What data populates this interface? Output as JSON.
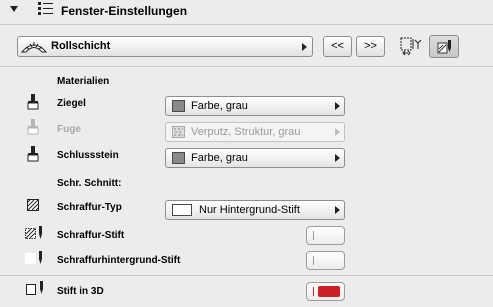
{
  "header": {
    "title": "Fenster-Einstellungen"
  },
  "profile": {
    "label": "Rollschicht",
    "prev_label": "<<",
    "next_label": ">>"
  },
  "materials": {
    "heading": "Materialien",
    "rows": [
      {
        "label": "Ziegel",
        "value": "Farbe, grau",
        "enabled": true
      },
      {
        "label": "Fuge",
        "value": "Verputz, Struktur, grau",
        "enabled": false
      },
      {
        "label": "Schlussstein",
        "value": "Farbe, grau",
        "enabled": true
      }
    ]
  },
  "cut": {
    "heading": "Schr. Schnitt:",
    "hatch_type": {
      "label": "Schraffur-Typ",
      "value": "Nur Hintergrund-Stift"
    },
    "hatch_pen": {
      "label": "Schraffur-Stift",
      "color": "#ffffff"
    },
    "hatch_bg_pen": {
      "label": "Schraffurhintergrund-Stift",
      "color": "#ffffff"
    }
  },
  "pen_3d": {
    "label": "Stift in 3D",
    "color": "#cc1f28"
  },
  "colors": {
    "swatch_grey": "#8a8a8a",
    "pen_red": "#cc1f28"
  }
}
